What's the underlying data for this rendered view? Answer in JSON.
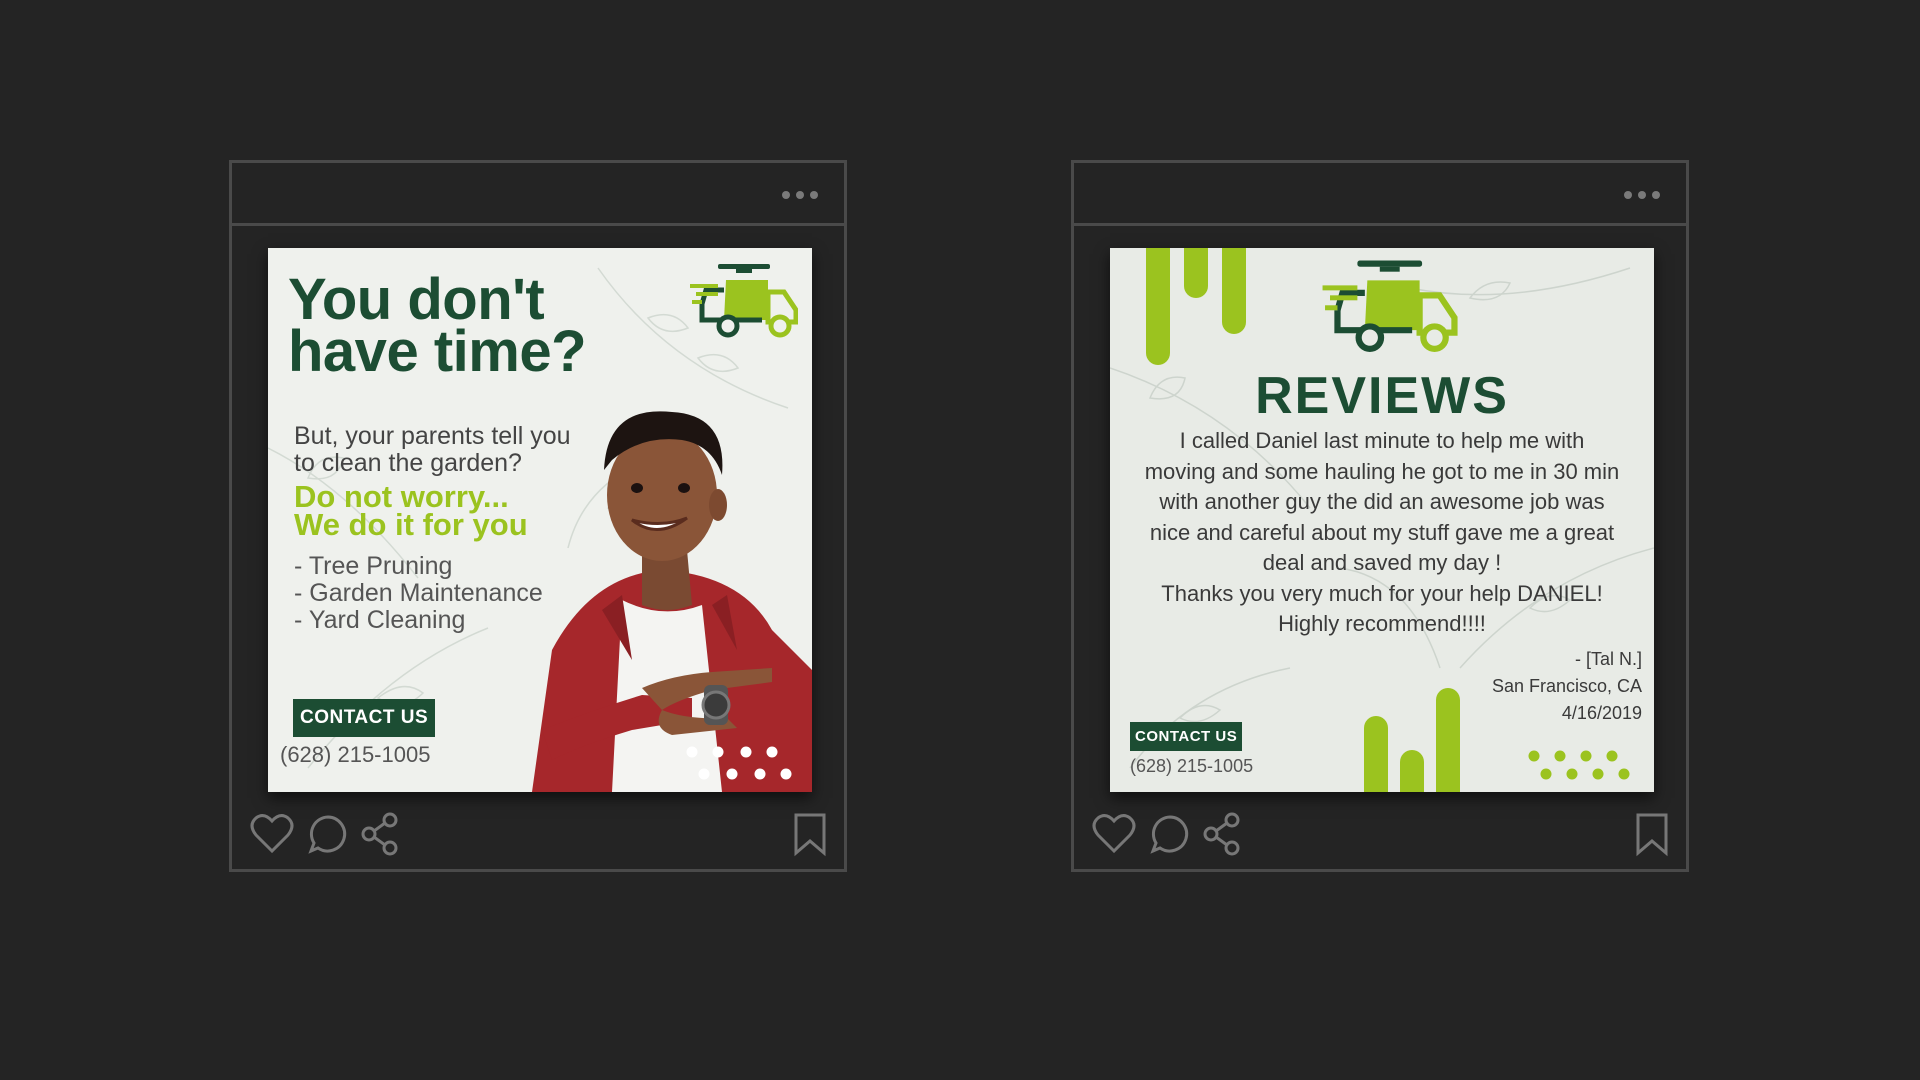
{
  "colors": {
    "background": "#242424",
    "frame": "#4a4a4a",
    "brand_dark_green": "#1c4d33",
    "brand_lime": "#9bc31f"
  },
  "left_post": {
    "headline_line1": "You don't",
    "headline_line2": "have time?",
    "sub_line1": "But, your parents tell you",
    "sub_line2": "to clean the garden?",
    "highlight_line1": "Do not worry...",
    "highlight_line2": "We do it for you",
    "services": [
      "- Tree Pruning",
      "- Garden Maintenance",
      "- Yard Cleaning"
    ],
    "cta_label": "CONTACT US",
    "phone": "(628) 215-1005",
    "logo_icon": "delivery-truck-icon",
    "photo": "man-pointing-at-watch"
  },
  "right_post": {
    "title": "REVIEWS",
    "review_lines": [
      "I called Daniel last minute to help me with",
      "moving and some hauling he got to me in 30 min",
      "with another guy the did an awesome job was",
      "nice and careful about my stuff gave me a great",
      "deal and saved my day !",
      "Thanks you very much for your help DANIEL!",
      "Highly recommend!!!!"
    ],
    "author": "- [Tal N.]",
    "location": "San Francisco, CA",
    "date": "4/16/2019",
    "cta_label": "CONTACT US",
    "phone": "(628) 215-1005",
    "logo_icon": "delivery-truck-icon"
  },
  "actions": {
    "icons": [
      "heart-icon",
      "comment-icon",
      "share-icon",
      "bookmark-icon"
    ]
  }
}
